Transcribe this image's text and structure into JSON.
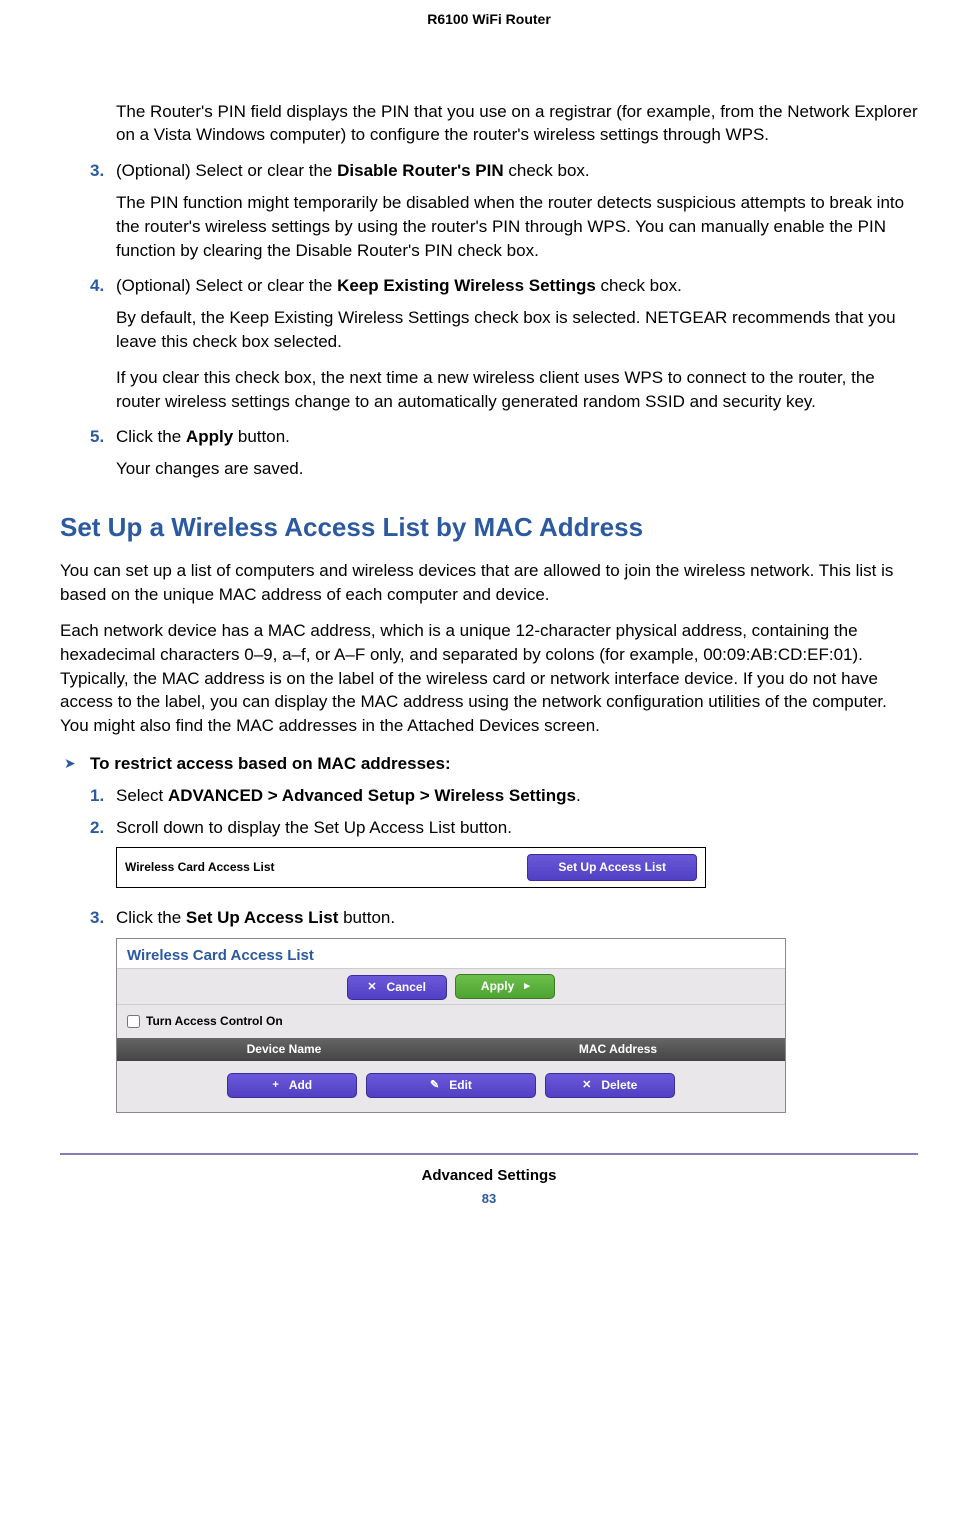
{
  "header": {
    "title": "R6100 WiFi Router"
  },
  "intro_para": "The Router's PIN field displays the PIN that you use on a registrar (for example, from the Network Explorer on a Vista Windows computer) to configure the router's wireless settings through WPS.",
  "step3": {
    "num": "3.",
    "text_a": "(Optional) Select or clear the ",
    "bold": "Disable Router's PIN",
    "text_b": " check box.",
    "sub": "The PIN function might temporarily be disabled when the router detects suspicious attempts to break into the router's wireless settings by using the router's PIN through WPS. You can manually enable the PIN function by clearing the Disable Router's PIN check box."
  },
  "step4": {
    "num": "4.",
    "text_a": "(Optional) Select or clear the ",
    "bold": "Keep Existing Wireless Settings",
    "text_b": " check box.",
    "sub1": "By default, the Keep Existing Wireless Settings check box is selected. NETGEAR recommends that you leave this check box selected.",
    "sub2": "If you clear this check box, the next time a new wireless client uses WPS to connect to the router, the router wireless settings change to an automatically generated random SSID and security key."
  },
  "step5": {
    "num": "5.",
    "text_a": "Click the ",
    "bold": "Apply",
    "text_b": " button.",
    "sub": "Your changes are saved."
  },
  "section_title": "Set Up a Wireless Access List by MAC Address",
  "section_p1": "You can set up a list of computers and wireless devices that are allowed to join the wireless network. This list is based on the unique MAC address of each computer and device.",
  "section_p2": "Each network device has a MAC address, which is a unique 12-character physical address, containing the hexadecimal characters 0–9, a–f, or A–F only, and separated by colons (for example, 00:09:AB:CD:EF:01). Typically, the MAC address is on the label of the wireless card or network interface device. If you do not have access to the label, you can display the MAC address using the network configuration utilities of the computer. You might also find the MAC addresses in the Attached Devices screen.",
  "proc": {
    "arrow": "➤",
    "title": "To restrict access based on MAC addresses:"
  },
  "pstep1": {
    "num": "1.",
    "text_a": "Select ",
    "bold": "ADVANCED > Advanced Setup > Wireless Settings",
    "text_b": "."
  },
  "pstep2": {
    "num": "2.",
    "text": "Scroll down to display the Set Up Access List button."
  },
  "shot1": {
    "label": "Wireless Card Access List",
    "button": "Set Up Access List"
  },
  "pstep3": {
    "num": "3.",
    "text_a": "Click the ",
    "bold": "Set Up Access List",
    "text_b": " button."
  },
  "shot2": {
    "title": "Wireless Card Access List",
    "cancel": "Cancel",
    "apply": "Apply",
    "check_label": "Turn Access Control On",
    "col1": "Device Name",
    "col2": "MAC Address",
    "add": "Add",
    "edit": "Edit",
    "delete": "Delete",
    "icon_x": "✕",
    "icon_arrow": "▸",
    "icon_plus": "+",
    "icon_pencil": "✎"
  },
  "footer": {
    "section": "Advanced Settings",
    "page": "83"
  }
}
